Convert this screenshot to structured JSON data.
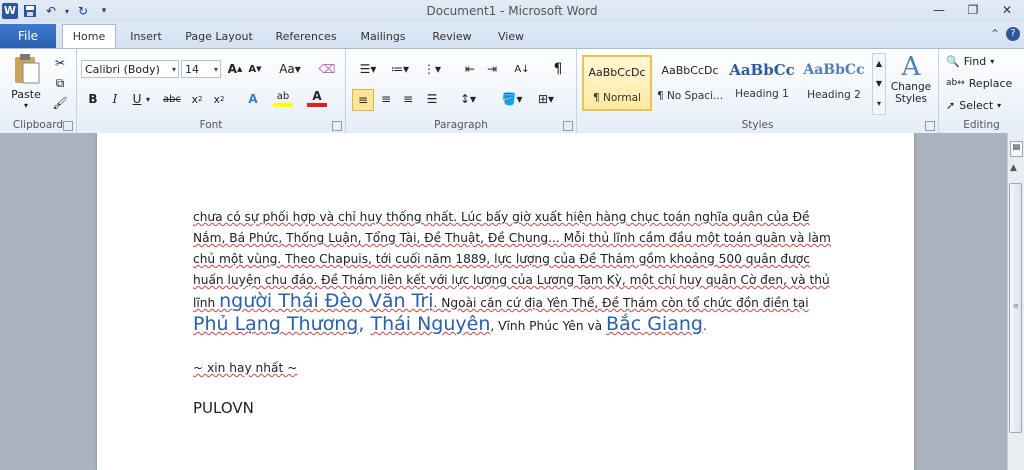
{
  "window": {
    "title": "Document1 - Microsoft Word"
  },
  "tabs": [
    {
      "label": "File"
    },
    {
      "label": "Home"
    },
    {
      "label": "Insert"
    },
    {
      "label": "Page Layout"
    },
    {
      "label": "References"
    },
    {
      "label": "Mailings"
    },
    {
      "label": "Review"
    },
    {
      "label": "View"
    }
  ],
  "clipboard": {
    "paste_label": "Paste",
    "group_label": "Clipboard"
  },
  "font": {
    "name": "Calibri (Body)",
    "size": "14",
    "group_label": "Font"
  },
  "paragraph": {
    "group_label": "Paragraph"
  },
  "styles": {
    "group_label": "Styles",
    "items": [
      {
        "sample": "AaBbCcDc",
        "name": "¶ Normal"
      },
      {
        "sample": "AaBbCcDc",
        "name": "¶ No Spaci..."
      },
      {
        "sample": "AaBbCc",
        "name": "Heading 1"
      },
      {
        "sample": "AaBbCc",
        "name": "Heading 2"
      }
    ],
    "change_label_1": "Change",
    "change_label_2": "Styles"
  },
  "editing": {
    "find": "Find",
    "replace": "Replace",
    "select": "Select",
    "group_label": "Editing"
  },
  "document": {
    "p1_a": "chưa có sự phối hợp và chỉ huy thống nhất. Lúc bấy giờ xuất hiện hàng chục toán nghĩa quân của Đề Nắm, Bá Phức, Thống Luận, Tổng Tài, Đề Thuật, Đề Chung... Mỗi thủ lĩnh cầm đầu một toán quân và làm chủ một vùng. Theo Chapuis, tới cuối năm 1889,  lực lượng của Đề Thám gồm khoảng 500  quân được huấn luyện chu đáo. Đề Thám liên kết với lực lượng của Lương Tam Kỳ, một chỉ huy quân Cờ đen, và thủ lĩnh ",
    "p1_big1": "người Thái Đèo Văn Trị",
    "p1_b": ". Ngoài căn cứ địa Yên Thế, Đề Thám còn tổ chức đồn điền tại ",
    "p1_big2": "Phủ Lạng Thương",
    "p1_c": ", ",
    "p1_big3": "Thái Nguyên",
    "p1_d": ", Vĩnh Phúc Yên và ",
    "p1_big4": "Bắc Giang",
    "p1_e": ".",
    "line2": "~ xin hay nhất ~",
    "line3": "PULOVN"
  }
}
